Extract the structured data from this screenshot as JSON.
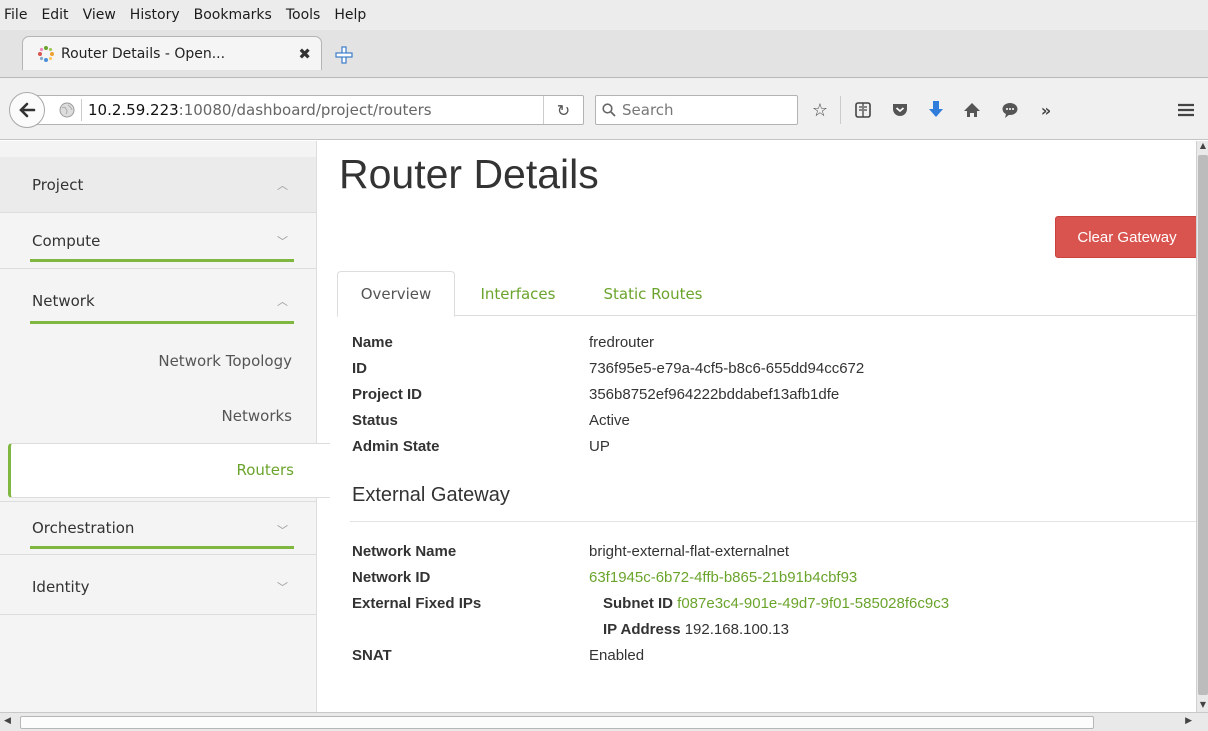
{
  "menubar": {
    "items": [
      "File",
      "Edit",
      "View",
      "History",
      "Bookmarks",
      "Tools",
      "Help"
    ]
  },
  "browser": {
    "tab_title": "Router Details - Open...",
    "url_host": "10.2.59.223",
    "url_path": ":10080/dashboard/project/routers",
    "search_placeholder": "Search",
    "toolbar_icons": [
      "star-icon",
      "reading-list-icon",
      "pocket-icon",
      "download-icon",
      "home-icon",
      "chat-icon",
      "overflow-icon",
      "hamburger-menu-icon"
    ]
  },
  "sidebar": {
    "project": "Project",
    "compute": "Compute",
    "network": "Network",
    "network_topology": "Network Topology",
    "networks": "Networks",
    "routers": "Routers",
    "orchestration": "Orchestration",
    "identity": "Identity"
  },
  "main": {
    "title": "Router Details",
    "clear_gateway": "Clear Gateway",
    "tabs": [
      "Overview",
      "Interfaces",
      "Static Routes"
    ],
    "overview": {
      "name_label": "Name",
      "name_value": "fredrouter",
      "id_label": "ID",
      "id_value": "736f95e5-e79a-4cf5-b8c6-655dd94cc672",
      "project_id_label": "Project ID",
      "project_id_value": "356b8752ef964222bddabef13afb1dfe",
      "status_label": "Status",
      "status_value": "Active",
      "admin_state_label": "Admin State",
      "admin_state_value": "UP"
    },
    "external_gateway": {
      "title": "External Gateway",
      "network_name_label": "Network Name",
      "network_name_value": "bright-external-flat-externalnet",
      "network_id_label": "Network ID",
      "network_id_value": "63f1945c-6b72-4ffb-b865-21b91b4cbf93",
      "fixed_ips_label": "External Fixed IPs",
      "subnet_id_label": "Subnet ID",
      "subnet_id_value": "f087e3c4-901e-49d7-9f01-585028f6c9c3",
      "ip_address_label": "IP Address",
      "ip_address_value": "192.168.100.13",
      "snat_label": "SNAT",
      "snat_value": "Enabled"
    }
  },
  "colors": {
    "accent_green": "#6ba42c",
    "danger_red": "#d9534f"
  }
}
